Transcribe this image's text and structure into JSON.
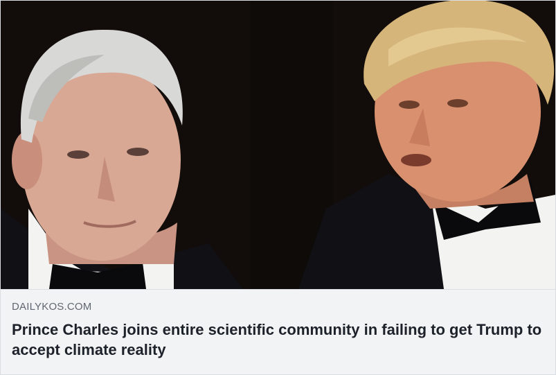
{
  "link_preview": {
    "image": {
      "description_icon": "photo-two-men-in-tuxedos",
      "palette": {
        "background": "#120d0a",
        "skin_left": "#d9a894",
        "skin_right": "#d9906f",
        "hair_left": "#d8d8d6",
        "hair_right": "#d6b57a",
        "suit": "#101015",
        "shirt": "#f3f3f1"
      }
    },
    "domain": "DAILYKOS.COM",
    "headline": "Prince Charles joins entire scientific community in failing to get Trump to accept climate reality"
  }
}
